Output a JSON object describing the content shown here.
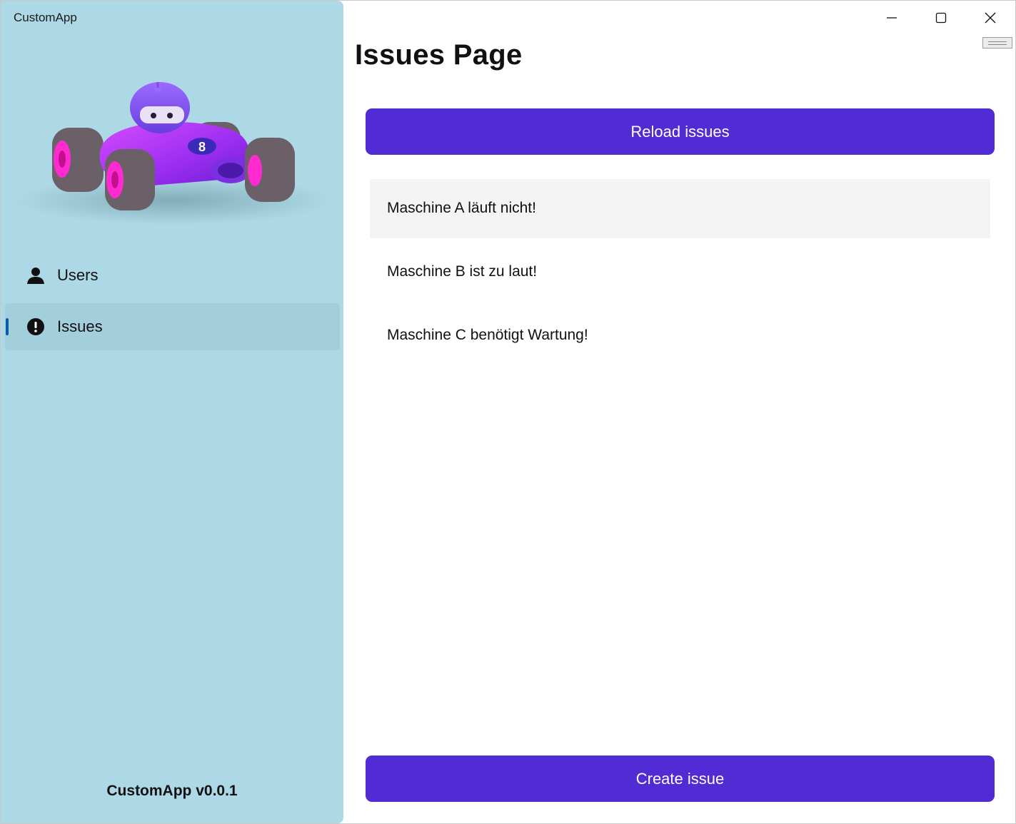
{
  "app": {
    "title": "CustomApp",
    "version": "CustomApp v0.0.1"
  },
  "window_controls": {
    "minimize_icon": "minimize-icon",
    "maximize_icon": "maximize-icon",
    "close_icon": "close-icon"
  },
  "sidebar": {
    "hero_image": "race-car-bot-illustration",
    "items": [
      {
        "label": "Users",
        "icon": "person-icon",
        "selected": false
      },
      {
        "label": "Issues",
        "icon": "exclamation-icon",
        "selected": true
      }
    ]
  },
  "main": {
    "title": "Issues Page",
    "reload_label": "Reload issues",
    "create_label": "Create issue",
    "issues": [
      {
        "text": "Maschine A läuft nicht!",
        "selected": true
      },
      {
        "text": "Maschine B ist zu laut!",
        "selected": false
      },
      {
        "text": "Maschine C benötigt Wartung!",
        "selected": false
      }
    ]
  },
  "colors": {
    "sidebar_bg": "#add8e6",
    "accent": "#512bd4",
    "selection_indicator": "#0a5ba8",
    "selected_row": "#f4f4f4"
  }
}
